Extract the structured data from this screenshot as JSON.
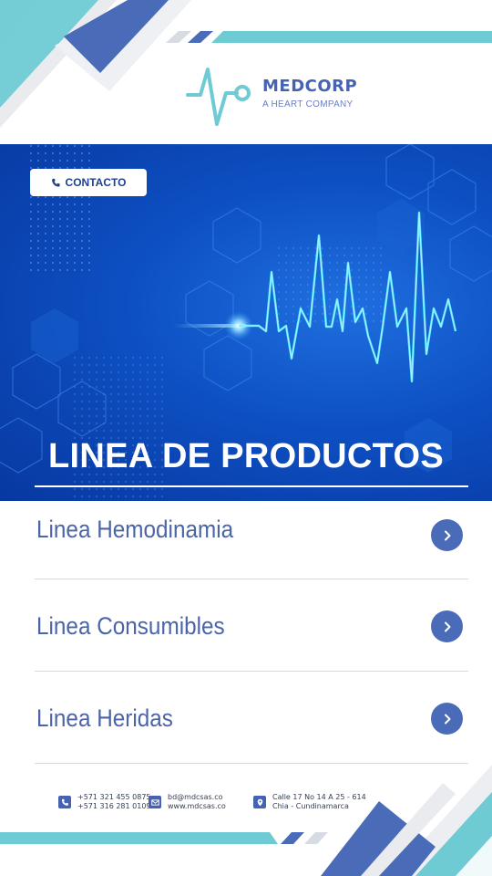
{
  "brand": {
    "name": "MEDCORP",
    "tagline": "A HEART COMPANY"
  },
  "hero": {
    "contact_label": "CONTACTO",
    "title": "LINEA DE PRODUCTOS"
  },
  "products": [
    {
      "label": "Linea Hemodinamia"
    },
    {
      "label": "Linea Consumibles"
    },
    {
      "label": "Linea Heridas"
    }
  ],
  "footer": {
    "phone_1": "+571 321 455 0875",
    "phone_2": "+571 316 281 0109",
    "email": "bd@mdcsas.co",
    "website": "www.mdcsas.co",
    "address_1": "Calle 17 No 14 A 25 - 614",
    "address_2": "Chia - Cundinamarca"
  },
  "colors": {
    "brand_blue": "#4663b3",
    "accent_teal": "#6ecad3",
    "hero_blue": "#0d4fc2"
  }
}
